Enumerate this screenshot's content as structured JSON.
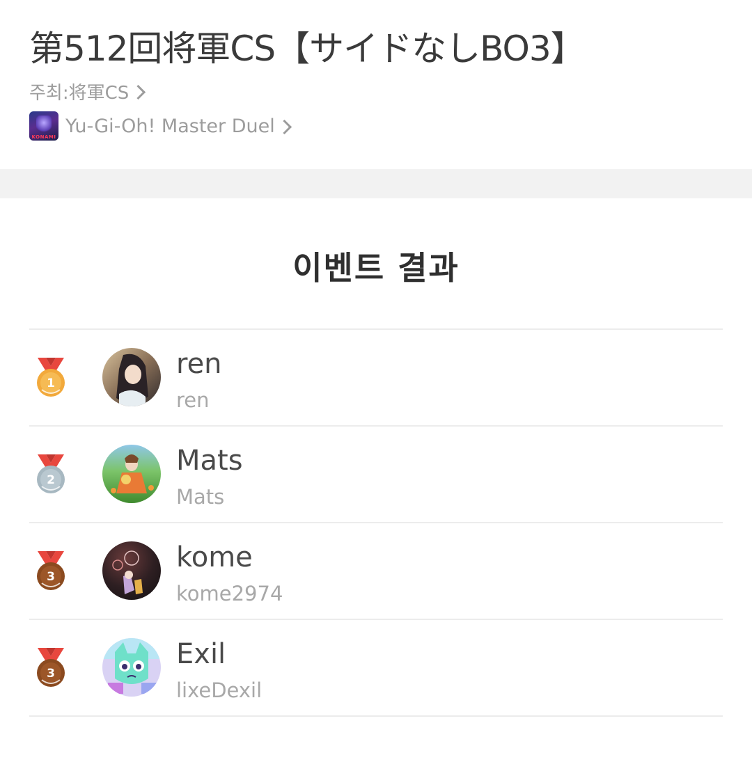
{
  "event": {
    "title": "第512回将軍CS【サイドなしBO3】",
    "host_label": "주최:将軍CS",
    "game_name": "Yu-Gi-Oh! Master Duel",
    "game_icon_text": "KONAMI"
  },
  "results": {
    "title": "이벤트 결과",
    "rows": [
      {
        "rank": "1",
        "name": "ren",
        "handle": "ren",
        "medal_color": "#f2a93b",
        "ribbon_color": "#e8473e"
      },
      {
        "rank": "2",
        "name": "Mats",
        "handle": "Mats",
        "medal_color": "#a7b8c1",
        "ribbon_color": "#e8473e"
      },
      {
        "rank": "3",
        "name": "kome",
        "handle": "kome2974",
        "medal_color": "#8b4a1f",
        "ribbon_color": "#e8473e"
      },
      {
        "rank": "3",
        "name": "Exil",
        "handle": "lixeDexil",
        "medal_color": "#8b4a1f",
        "ribbon_color": "#e8473e"
      }
    ]
  }
}
